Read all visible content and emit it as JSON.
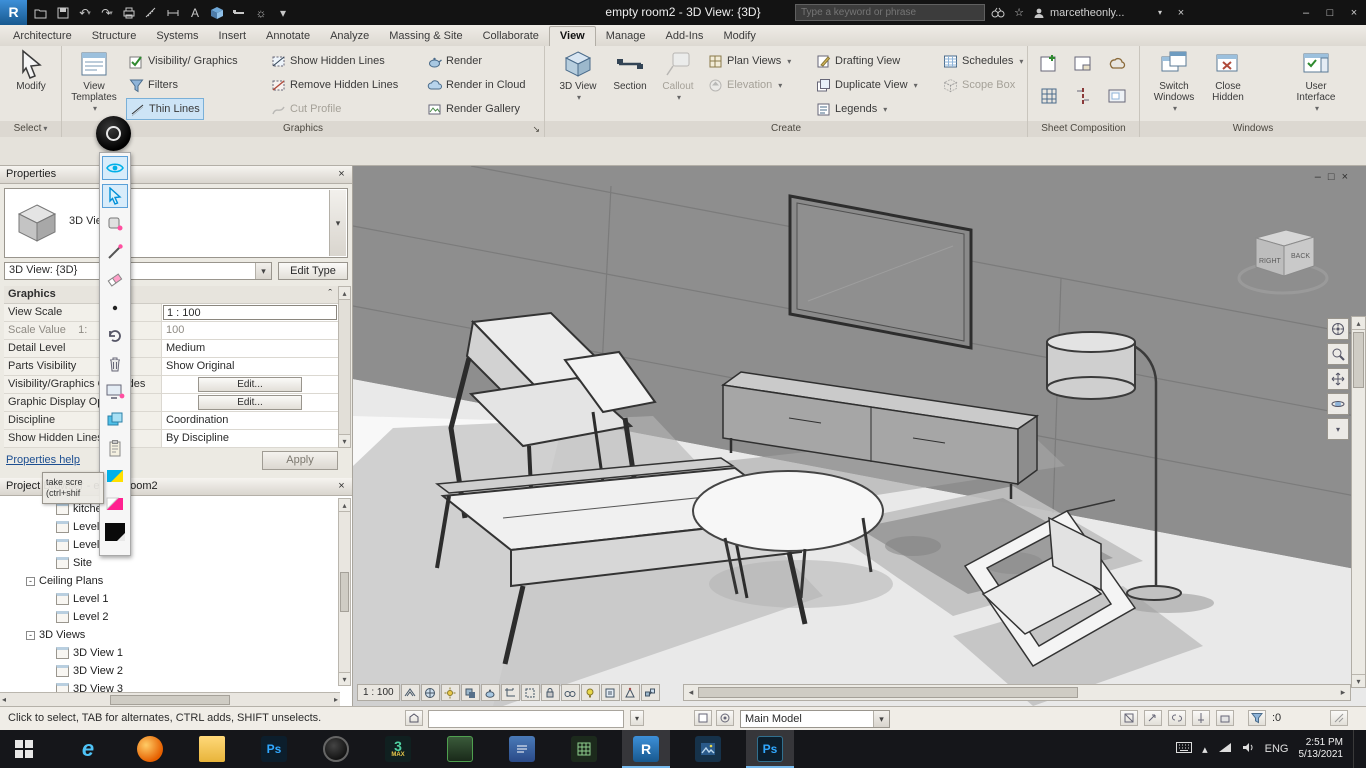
{
  "glyphs": {
    "dropdown": "▾",
    "close": "×",
    "minimize": "–",
    "maximize": "□",
    "launcher": "↘",
    "left": "◂",
    "right": "▸",
    "up": "▴",
    "down": "▾",
    "collapse": "ˆ",
    "expander": "-",
    "undo": "↶",
    "redo": "↷",
    "sun": "☼",
    "text_tool": "A",
    "star": "☆"
  },
  "titlebar": {
    "logo_letter": "R",
    "app_title": "empty room2 - 3D View: {3D}",
    "search_placeholder": "Type a keyword or phrase",
    "username": "marcetheonly..."
  },
  "ribbon": {
    "tabs": [
      {
        "label": "Architecture"
      },
      {
        "label": "Structure"
      },
      {
        "label": "Systems"
      },
      {
        "label": "Insert"
      },
      {
        "label": "Annotate"
      },
      {
        "label": "Analyze"
      },
      {
        "label": "Massing & Site"
      },
      {
        "label": "Collaborate"
      },
      {
        "label": "View"
      },
      {
        "label": "Manage"
      },
      {
        "label": "Add-Ins"
      },
      {
        "label": "Modify"
      }
    ],
    "active_tab": "View",
    "select": {
      "modify": "Modify",
      "panel_label": "Select"
    },
    "graphics": {
      "panel_label": "Graphics",
      "view_templates": "View Templates",
      "visibility_graphics": "Visibility/ Graphics",
      "filters": "Filters",
      "thin_lines": "Thin Lines",
      "show_hidden_lines": "Show Hidden Lines",
      "remove_hidden_lines": "Remove Hidden Lines",
      "cut_profile": "Cut Profile",
      "render": "Render",
      "render_in_cloud": "Render in Cloud",
      "render_gallery": "Render Gallery"
    },
    "create": {
      "panel_label": "Create",
      "view_3d": "3D View",
      "section": "Section",
      "callout": "Callout",
      "plan_views": "Plan Views",
      "elevation": "Elevation",
      "drafting_view": "Drafting View",
      "duplicate_view": "Duplicate View",
      "legends": "Legends",
      "schedules": "Schedules",
      "scope_box": "Scope Box"
    },
    "sheet_composition": {
      "panel_label": "Sheet Composition"
    },
    "windows": {
      "panel_label": "Windows",
      "switch_windows": "Switch Windows",
      "close_hidden": "Close Hidden",
      "user_interface": "User Interface"
    }
  },
  "properties": {
    "title": "Properties",
    "type_label": "3D View",
    "view_combo": "3D View: {3D}",
    "edit_type": "Edit Type",
    "group_label": "Graphics",
    "rows": [
      {
        "label": "View Scale",
        "value": "1 : 100"
      },
      {
        "label": "Scale Value    1:",
        "value": "100"
      },
      {
        "label": "Detail Level",
        "value": "Medium"
      },
      {
        "label": "Parts Visibility",
        "value": "Show Original"
      },
      {
        "label": "Visibility/Graphics Overrides",
        "value": "Edit..."
      },
      {
        "label": "Graphic Display Options",
        "value": "Edit..."
      },
      {
        "label": "Discipline",
        "value": "Coordination"
      },
      {
        "label": "Show Hidden Lines",
        "value": "By Discipline"
      }
    ],
    "help_link": "Properties help",
    "apply": "Apply"
  },
  "capture_tool": {
    "tooltip_line1": "take scre",
    "tooltip_line2": "(ctrl+shif"
  },
  "project_browser": {
    "title": "Project Browser - empty room2",
    "items": [
      {
        "label": "kitchen"
      },
      {
        "label": "Level 1"
      },
      {
        "label": "Level 2"
      },
      {
        "label": "Site"
      },
      {
        "label": "Ceiling Plans"
      },
      {
        "label": "Level 1"
      },
      {
        "label": "Level 2"
      },
      {
        "label": "3D Views"
      },
      {
        "label": "3D View 1"
      },
      {
        "label": "3D View 2"
      },
      {
        "label": "3D View 3"
      }
    ]
  },
  "viewport": {
    "scale_label": "1 : 100",
    "viewcube_front": "RIGHT",
    "viewcube_side": "BACK",
    "scene_objects": [
      "wall-panels",
      "tv-screen",
      "media-console",
      "floor-lamp",
      "lounge-chair-left",
      "daybed-bench",
      "coffee-table",
      "lounge-chair-right",
      "area-rug",
      "floor-shadows"
    ]
  },
  "status_bar": {
    "hint": "Click to select, TAB for alternates, CTRL adds, SHIFT unselects.",
    "design_option": "Main Model",
    "filter_count": ":0"
  },
  "taskbar": {
    "apps": [
      {
        "glyph": "e"
      },
      {
        "glyph": ""
      },
      {
        "glyph": ""
      },
      {
        "glyph": "Ps"
      },
      {
        "glyph": ""
      },
      {
        "glyph": "3",
        "sub": "MAX"
      },
      {
        "glyph": ""
      },
      {
        "glyph": ""
      },
      {
        "glyph": ""
      },
      {
        "glyph": "R"
      },
      {
        "glyph": ""
      },
      {
        "glyph": "Ps"
      }
    ],
    "language": "ENG",
    "time": "2:51 PM",
    "date": "5/13/2021"
  }
}
